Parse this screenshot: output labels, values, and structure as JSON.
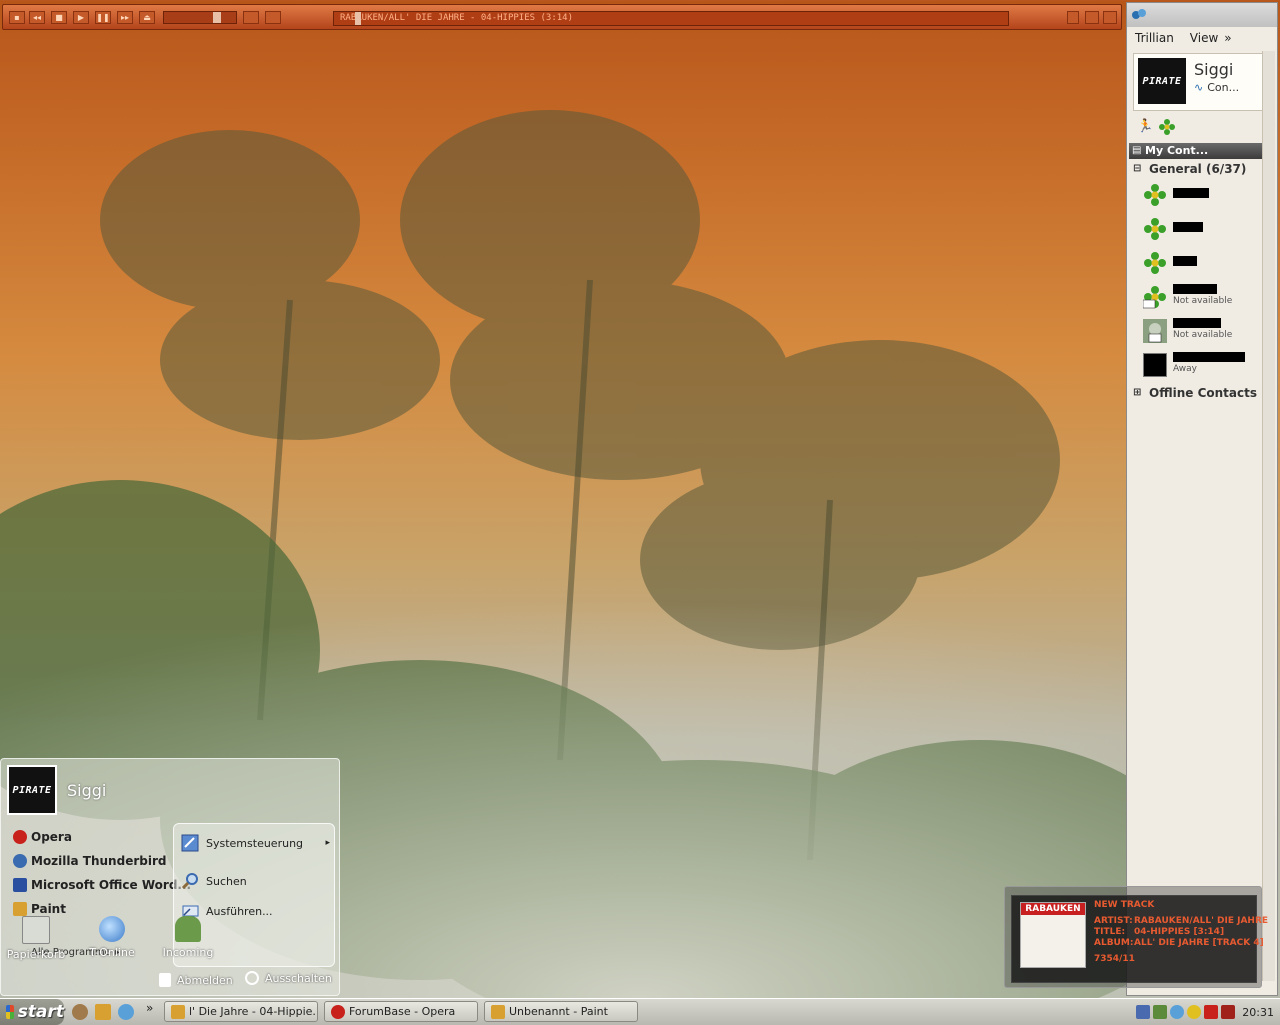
{
  "winamp": {
    "now_playing": "RABAUKEN/ALL' DIE JAHRE - 04-HIPPIES (3:14)"
  },
  "trillian": {
    "menu": {
      "trillian": "Trillian",
      "view": "View",
      "more": "»"
    },
    "profile": {
      "name": "Siggi",
      "status": "Con...",
      "logo": "PIRATE"
    },
    "contacts_header": "My Cont...",
    "group_label": "General (6/37)",
    "contacts": [
      {
        "status": ""
      },
      {
        "status": ""
      },
      {
        "status": ""
      },
      {
        "status": "Not available"
      },
      {
        "status": "Not available"
      },
      {
        "status": "Away"
      }
    ],
    "offline_label": "Offline Contacts"
  },
  "start_menu": {
    "user": "Siggi",
    "logo": "PIRATE",
    "left_items": [
      "Opera",
      "Mozilla Thunderbird",
      "Microsoft Office Word...",
      "Paint"
    ],
    "all_programs": "Alle Programme",
    "right_items": [
      "Systemsteuerung",
      "Suchen",
      "Ausführen..."
    ],
    "logoff": "Abmelden",
    "shutdown": "Ausschalten"
  },
  "desktop_icons": [
    "Papierkorb",
    "T-Online",
    "Incoming"
  ],
  "notification": {
    "header": "NEW TRACK",
    "artist_label": "ARTIST:",
    "artist": "RABAUKEN/ALL' DIE JAHRE",
    "title_label": "TITLE:",
    "title": "04-HIPPIES [3:14]",
    "album_label": "ALBUM:",
    "album": "ALL' DIE JAHRE [TRACK 4]",
    "counter": "7354/11",
    "cover_text": "RABAUKEN"
  },
  "taskbar": {
    "start_label": "start",
    "more": "»",
    "tasks": [
      "l' Die Jahre - 04-Hippie...",
      "ForumBase - Opera",
      "Unbenannt - Paint"
    ],
    "clock": "20:31"
  },
  "colors": {
    "accent": "#e85a30",
    "sky_top": "#b8561a",
    "sky_mid": "#d58b40"
  }
}
